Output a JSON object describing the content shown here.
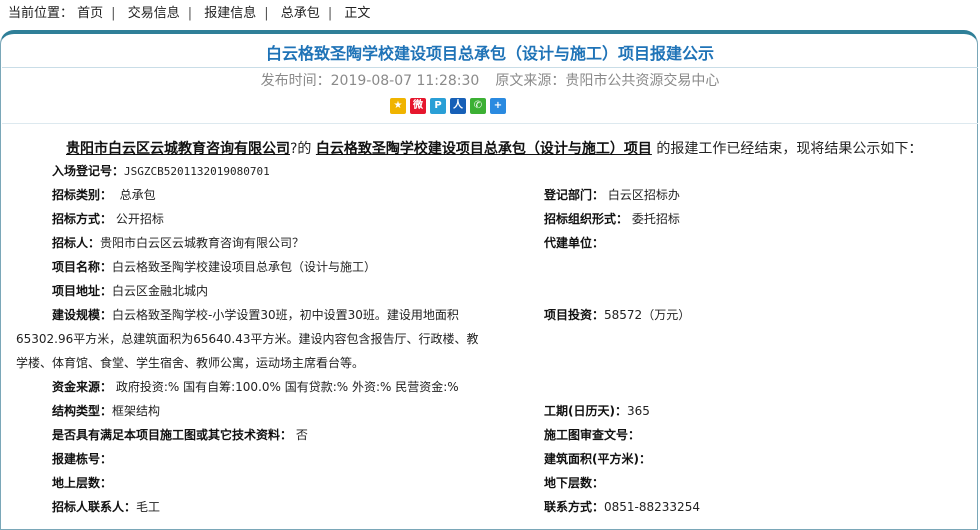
{
  "breadcrumb": {
    "prefix": "当前位置：",
    "items": [
      "首页",
      "交易信息",
      "报建信息",
      "总承包",
      "正文"
    ]
  },
  "article": {
    "title": "白云格致圣陶学校建设项目总承包（设计与施工）项目报建公示",
    "publish_label": "发布时间：",
    "publish_time": "2019-08-07 11:28:30",
    "source_label": "原文来源：",
    "source": "贵阳市公共资源交易中心"
  },
  "share_icons": [
    {
      "name": "qzone-icon",
      "glyph": "★",
      "color": "#f0b400"
    },
    {
      "name": "weibo-icon",
      "glyph": "微",
      "color": "#e6162d"
    },
    {
      "name": "tencent-weibo-icon",
      "glyph": "P",
      "color": "#2a9fd6"
    },
    {
      "name": "renren-icon",
      "glyph": "人",
      "color": "#1760b7"
    },
    {
      "name": "wechat-icon",
      "glyph": "✆",
      "color": "#3cb034"
    },
    {
      "name": "more-share-icon",
      "glyph": "+",
      "color": "#2a8ae0"
    }
  ],
  "intro": {
    "company": "贵阳市白云区云城教育咨询有限公司",
    "connector": "?的",
    "project": "白云格致圣陶学校建设项目总承包（设计与施工）项目",
    "suffix": " 的报建工作已经结束，现将结果公示如下："
  },
  "fields": {
    "entry_no_label": "入场登记号：",
    "entry_no": "JSGZCB5201132019080701",
    "bid_type_label": "招标类别：",
    "bid_type": "总承包",
    "reg_dept_label": "登记部门：",
    "reg_dept": "白云区招标办",
    "bid_method_label": "招标方式：",
    "bid_method": "公开招标",
    "bid_org_form_label": "招标组织形式：",
    "bid_org_form": "委托招标",
    "tenderer_label": "招标人：",
    "tenderer": "贵阳市白云区云城教育咨询有限公司？",
    "agent_label": "代建单位：",
    "project_name_label": "项目名称：",
    "project_name": "白云格致圣陶学校建设项目总承包（设计与施工）",
    "project_addr_label": "项目地址：",
    "project_addr": "白云区金融北城内",
    "scale_label": "建设规模：",
    "scale_line1": "白云格致圣陶学校-小学设置30班，初中设置30班。建设用地面积",
    "scale_line2": "65302.96平方米，总建筑面积为65640.43平方米。建设内容包含报告厅、行政楼、教",
    "scale_line3": "学楼、体育馆、食堂、学生宿舍、教师公寓，运动场主席看台等。",
    "investment_label": "项目投资：",
    "investment": "58572（万元）",
    "funding_label": "资金来源：",
    "funding": "政府投资:% 国有自筹:100.0% 国有贷款:% 外资:% 民营资金:%",
    "structure_label": "结构类型：",
    "structure": "框架结构",
    "duration_label": "工期(日历天)：",
    "duration": "365",
    "drawings_label": "是否具有满足本项目施工图或其它技术资料：",
    "drawings": "否",
    "drawing_review_label": "施工图审查文号：",
    "building_no_label": "报建栋号：",
    "building_area_label": "建筑面积(平方米)：",
    "above_floors_label": "地上层数：",
    "below_floors_label": "地下层数：",
    "contact_label": "招标人联系人：",
    "contact": "毛工",
    "phone_label": "联系方式：",
    "phone": "0851-88233254"
  }
}
